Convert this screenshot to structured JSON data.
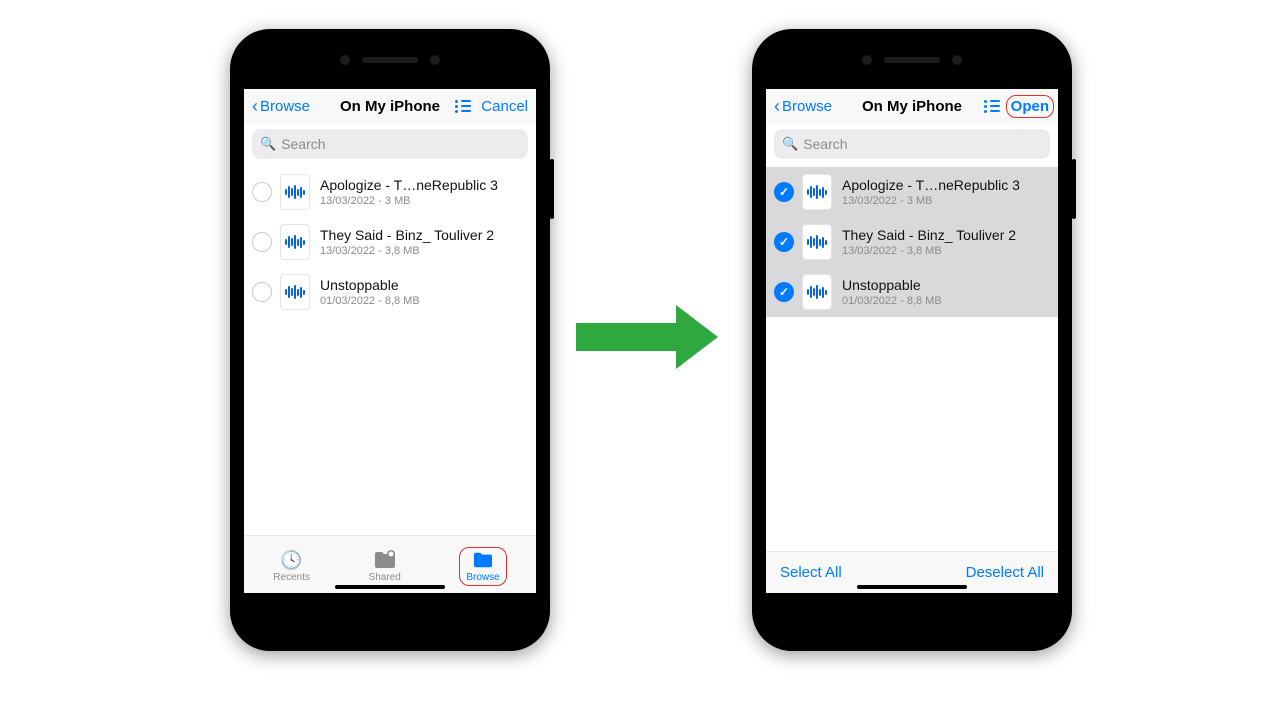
{
  "nav": {
    "back": "Browse",
    "title": "On My iPhone",
    "cancel": "Cancel",
    "open": "Open"
  },
  "search": {
    "placeholder": "Search"
  },
  "files": [
    {
      "name": "Apologize - T…neRepublic 3",
      "sub": "13/03/2022 - 3 MB"
    },
    {
      "name": "They Said - Binz_ Touliver 2",
      "sub": "13/03/2022 - 3,8 MB"
    },
    {
      "name": "Unstoppable",
      "sub": "01/03/2022 - 8,8 MB"
    }
  ],
  "tabs": {
    "recents": "Recents",
    "shared": "Shared",
    "browse": "Browse"
  },
  "footer": {
    "selectAll": "Select All",
    "deselectAll": "Deselect All"
  }
}
